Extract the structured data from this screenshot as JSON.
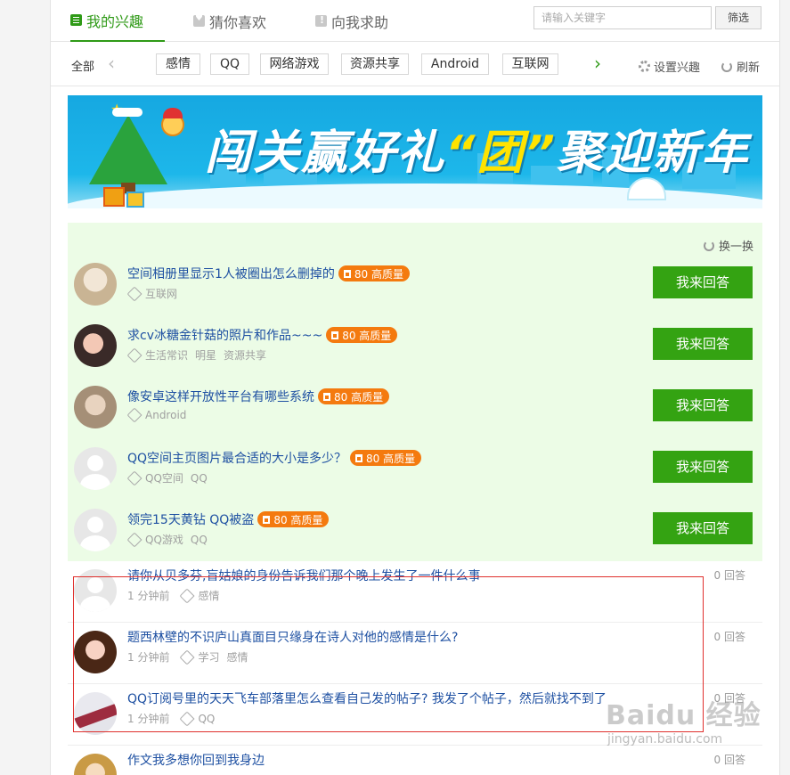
{
  "tabs": [
    {
      "label": "我的兴趣",
      "icon": "list-icon",
      "active": true
    },
    {
      "label": "猜你喜欢",
      "icon": "heart-icon",
      "active": false
    },
    {
      "label": "向我求助",
      "icon": "help-icon",
      "active": false
    }
  ],
  "search": {
    "placeholder": "请输入关键字",
    "button_label": "筛选"
  },
  "categories": {
    "all_label": "全部",
    "items": [
      "感情",
      "QQ",
      "网络游戏",
      "资源共享",
      "Android",
      "互联网"
    ],
    "settings_label": "设置兴趣",
    "refresh_label": "刷新"
  },
  "banner": {
    "text_part1": "闯关赢好礼",
    "text_highlight": "“团”",
    "text_part2": "聚迎新年"
  },
  "recommended": {
    "swap_label": "换一换",
    "answer_label": "我来回答",
    "items": [
      {
        "title": "空间相册里显示1人被圈出怎么删掉的",
        "badge": "80 高质量",
        "tags": [
          "互联网"
        ]
      },
      {
        "title": "求cv冰糖金针菇的照片和作品~~~",
        "badge": "80 高质量",
        "tags": [
          "生活常识",
          "明星",
          "资源共享"
        ]
      },
      {
        "title": "像安卓这样开放性平台有哪些系统",
        "badge": "80 高质量",
        "tags": [
          "Android"
        ]
      },
      {
        "title": "QQ空间主页图片最合适的大小是多少？",
        "badge": "80 高质量",
        "tags": [
          "QQ空间",
          "QQ"
        ]
      },
      {
        "title": "领完15天黄钻 QQ被盗",
        "badge": "80 高质量",
        "tags": [
          "QQ游戏",
          "QQ"
        ]
      }
    ]
  },
  "latest": [
    {
      "title": "请你从贝多芬,盲姑娘的身份告诉我们那个晚上发生了一件什么事",
      "time": "1 分钟前",
      "tags": [
        "感情"
      ],
      "answers": "0 回答"
    },
    {
      "title": "题西林壁的不识庐山真面目只缘身在诗人对他的感情是什么?",
      "time": "1 分钟前",
      "tags": [
        "学习",
        "感情"
      ],
      "answers": "0 回答"
    },
    {
      "title": "QQ订阅号里的天天飞车部落里怎么查看自己发的帖子? 我发了个帖子，然后就找不到了",
      "time": "1 分钟前",
      "tags": [
        "QQ"
      ],
      "answers": "0 回答"
    },
    {
      "title": "作文我多想你回到我身边",
      "time": "",
      "tags": [],
      "answers": "0 回答"
    }
  ],
  "watermark": {
    "logo": "Baidu 经验",
    "url": "jingyan.baidu.com"
  },
  "colors": {
    "accent": "#2f9a17",
    "answer_button": "#34a312",
    "badge": "#f47a0f",
    "link": "#1e50a2",
    "rec_bg": "#ecfce6",
    "highlight_box": "#e0302d"
  }
}
